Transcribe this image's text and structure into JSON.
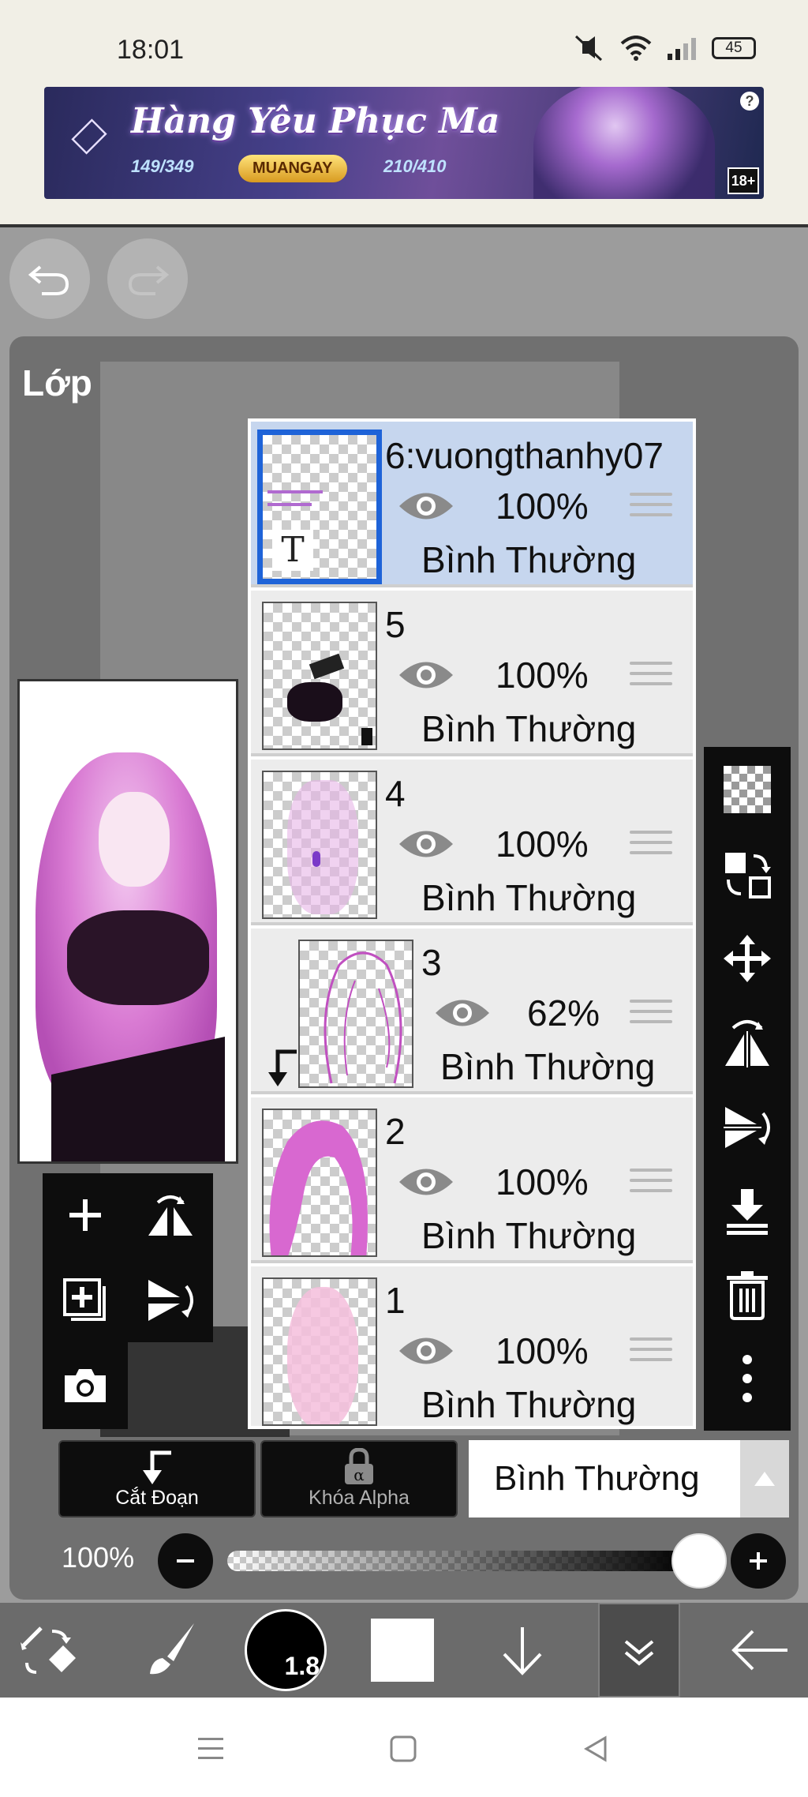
{
  "status_bar": {
    "time": "18:01",
    "battery": "45"
  },
  "ad": {
    "title": "Hàng Yêu Phục Ma",
    "price_left": "149/349",
    "button": "MUANGAY",
    "price_right": "210/410",
    "age_rating": "18+",
    "help": "?"
  },
  "panel": {
    "title": "Lớp"
  },
  "layers": [
    {
      "name": "6:vuongthanhy07",
      "opacity": "100%",
      "blend": "Bình Thường",
      "selected": true,
      "text_layer_icon": "T"
    },
    {
      "name": "5",
      "opacity": "100%",
      "blend": "Bình Thường"
    },
    {
      "name": "4",
      "opacity": "100%",
      "blend": "Bình Thường"
    },
    {
      "name": "3",
      "opacity": "62%",
      "blend": "Bình Thường",
      "clipped": true
    },
    {
      "name": "2",
      "opacity": "100%",
      "blend": "Bình Thường"
    },
    {
      "name": "1",
      "opacity": "100%",
      "blend": "Bình Thường"
    }
  ],
  "controls": {
    "clip_label": "Cắt Đoạn",
    "alpha_lock_label": "Khóa Alpha",
    "blend_mode": "Bình Thường",
    "opacity_label": "100%",
    "opacity_value": 1.0
  },
  "toolbar": {
    "brush_size": "1.8"
  },
  "colors": {
    "accent_selected": "#1e63d8",
    "selected_row": "#c6d6ee",
    "panel": "#707070",
    "toolbar": "#0d0d0d"
  },
  "icons": {
    "right_toolbar": [
      "transparency-icon",
      "layer-move-icon",
      "move-icon",
      "flip-horizontal-icon",
      "flip-vertical-icon",
      "merge-down-icon",
      "trash-icon",
      "more-icon"
    ],
    "left_toolbox": [
      "add-layer-icon",
      "flip-layer-icon",
      "add-canvas-layer-icon",
      "flip-vertical-layer-icon",
      "camera-icon"
    ],
    "bottom_toolbar": [
      "tool-switch-icon",
      "brush-icon",
      "brush-size",
      "color-swatch",
      "down-arrow-icon",
      "collapse-icon",
      "back-arrow-icon"
    ]
  }
}
